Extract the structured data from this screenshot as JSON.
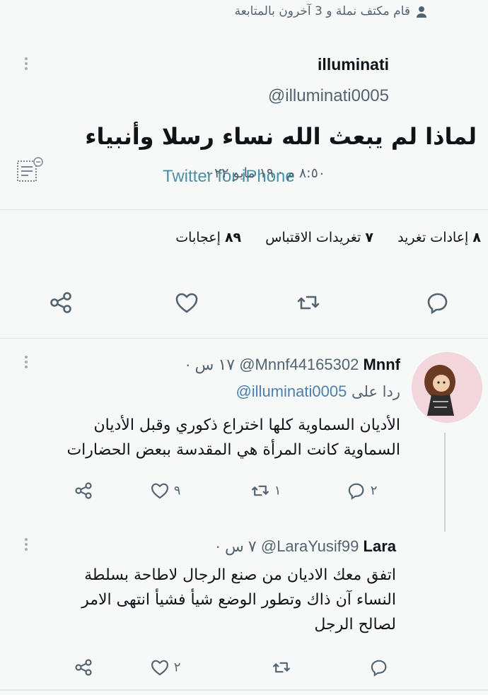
{
  "header": {
    "followed_text": "قام مكتف نملة و 3 آخرون بالمتابعة"
  },
  "tweet": {
    "name": "illuminati",
    "handle": "@illuminati0005",
    "text": "لماذا لم يبعث الله نساء رسلا وأنبياء",
    "datetime": "٨:٥٠ م · ١٩ مايو ٢٢ ·",
    "source": "Twitter for iPhone",
    "stats": {
      "retweets_count": "٨",
      "retweets_label": "إعادات تغريد",
      "quotes_count": "٧",
      "quotes_label": "تغريدات الاقتباس",
      "likes_count": "٨٩",
      "likes_label": "إعجابات"
    }
  },
  "replies": [
    {
      "name": "Mnnf",
      "handle": "@Mnnf44165302",
      "time": "· ١٧ س",
      "reply_to_label": "ردا على",
      "reply_to_handle": "@illuminati0005",
      "text_line1": "الأديان السماوية كلها اختراع ذكوري وقبل الأديان",
      "text_line2": "السماوية كانت المرأة هي المقدسة ببعض الحضارات",
      "replies_count": "٢",
      "retweets_count": "١",
      "likes_count": "٩"
    },
    {
      "name": "Lara",
      "handle": "@LaraYusif99",
      "time": "· ٧ س",
      "text_line1": "اتفق معك الاديان  من صنع الرجال لاطاحة بسلطة",
      "text_line2": "النساء آن ذاك وتطور الوضع شيأ فشيأ انتهى الامر",
      "text_line3": "لصالح الرجل",
      "likes_count": "٢"
    }
  ],
  "colors": {
    "text": "#0f1419",
    "secondary": "#536471",
    "link": "#4a7fb0",
    "divider": "#dfe4e8"
  },
  "icons": [
    "person-icon",
    "more-icon",
    "note-icon",
    "reply-icon",
    "retweet-icon",
    "like-icon",
    "share-icon"
  ]
}
